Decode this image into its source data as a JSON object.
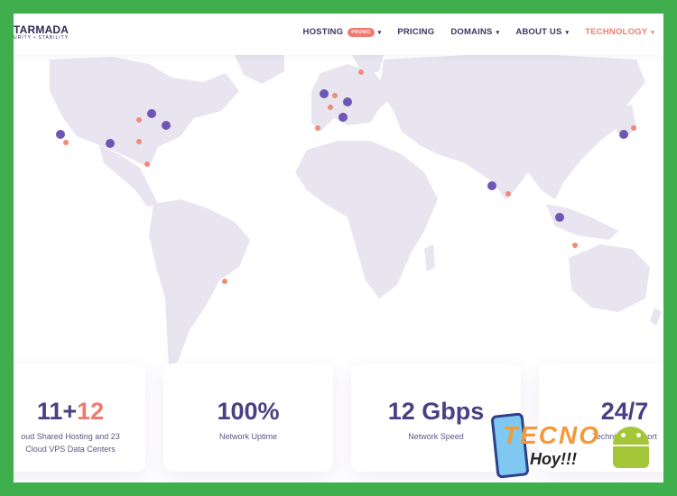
{
  "brand": {
    "name": "TARMADA",
    "tagline": "URITY • STABILITY"
  },
  "nav": [
    {
      "label": "HOSTING",
      "badge": "PROMO",
      "has_dropdown": true,
      "active": false
    },
    {
      "label": "PRICING",
      "has_dropdown": false,
      "active": false
    },
    {
      "label": "DOMAINS",
      "has_dropdown": true,
      "active": false
    },
    {
      "label": "ABOUT US",
      "has_dropdown": true,
      "active": false
    },
    {
      "label": "TECHNOLOGY",
      "has_dropdown": true,
      "active": true
    }
  ],
  "stats": [
    {
      "value_a": "11+",
      "value_b": "12",
      "label_1": "oud Shared Hosting and 23",
      "label_2": "Cloud VPS Data Centers"
    },
    {
      "value": "100%",
      "label": "Network Uptime"
    },
    {
      "value": "12 Gbps",
      "label": "Network Speed"
    },
    {
      "value": "24/7",
      "label": "Technical Support"
    }
  ],
  "watermark": {
    "line1": "TECNO",
    "line2": "Hoy!!!"
  },
  "colors": {
    "accent": "#f07a6f",
    "primary": "#4a3f84",
    "land": "#e8e5f1",
    "frame": "#3fae4c"
  }
}
